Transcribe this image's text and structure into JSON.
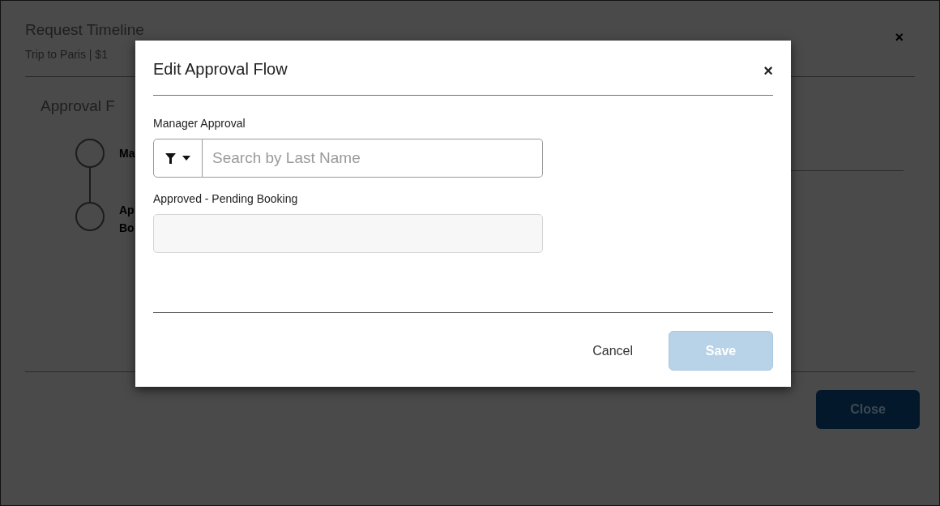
{
  "background": {
    "title": "Request Timeline",
    "subtitle": "Trip to Paris | $1",
    "section_title": "Approval F",
    "steps": [
      {
        "lines": [
          "Ma"
        ]
      },
      {
        "lines": [
          "Ap",
          "Bo"
        ]
      }
    ],
    "close_icon": "×",
    "close_button": "Close"
  },
  "dialog": {
    "title": "Edit Approval Flow",
    "close": "×",
    "fields": [
      {
        "kind": "search",
        "label": "Manager Approval",
        "placeholder": "Search by Last Name"
      },
      {
        "kind": "plain",
        "label": "Approved - Pending Booking"
      }
    ],
    "buttons": [
      {
        "label": "Cancel",
        "kind": "link",
        "disabled": false
      },
      {
        "label": "Save",
        "kind": "primary",
        "disabled": true
      }
    ]
  }
}
